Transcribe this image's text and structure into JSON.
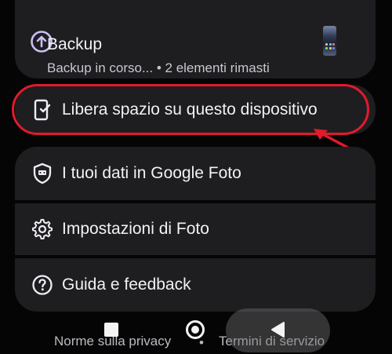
{
  "backup": {
    "title": "Backup",
    "subtitle": "Backup in corso... • 2 elementi rimasti",
    "icon": "backup-upload-icon"
  },
  "free_space": {
    "label": "Libera spazio su questo dispositivo",
    "icon": "phone-check-icon"
  },
  "menu": {
    "items": [
      {
        "label": "I tuoi dati in Google Foto",
        "icon": "shield-data-icon"
      },
      {
        "label": "Impostazioni di Foto",
        "icon": "gear-icon"
      },
      {
        "label": "Guida e feedback",
        "icon": "help-circle-icon"
      }
    ]
  },
  "footer": {
    "privacy": "Norme sulla privacy",
    "separator": "•",
    "terms": "Termini di servizio"
  },
  "colors": {
    "background": "#050505",
    "card": "#1e1e21",
    "accent_icon": "#cdbdf2",
    "highlight": "#e21a2c"
  }
}
